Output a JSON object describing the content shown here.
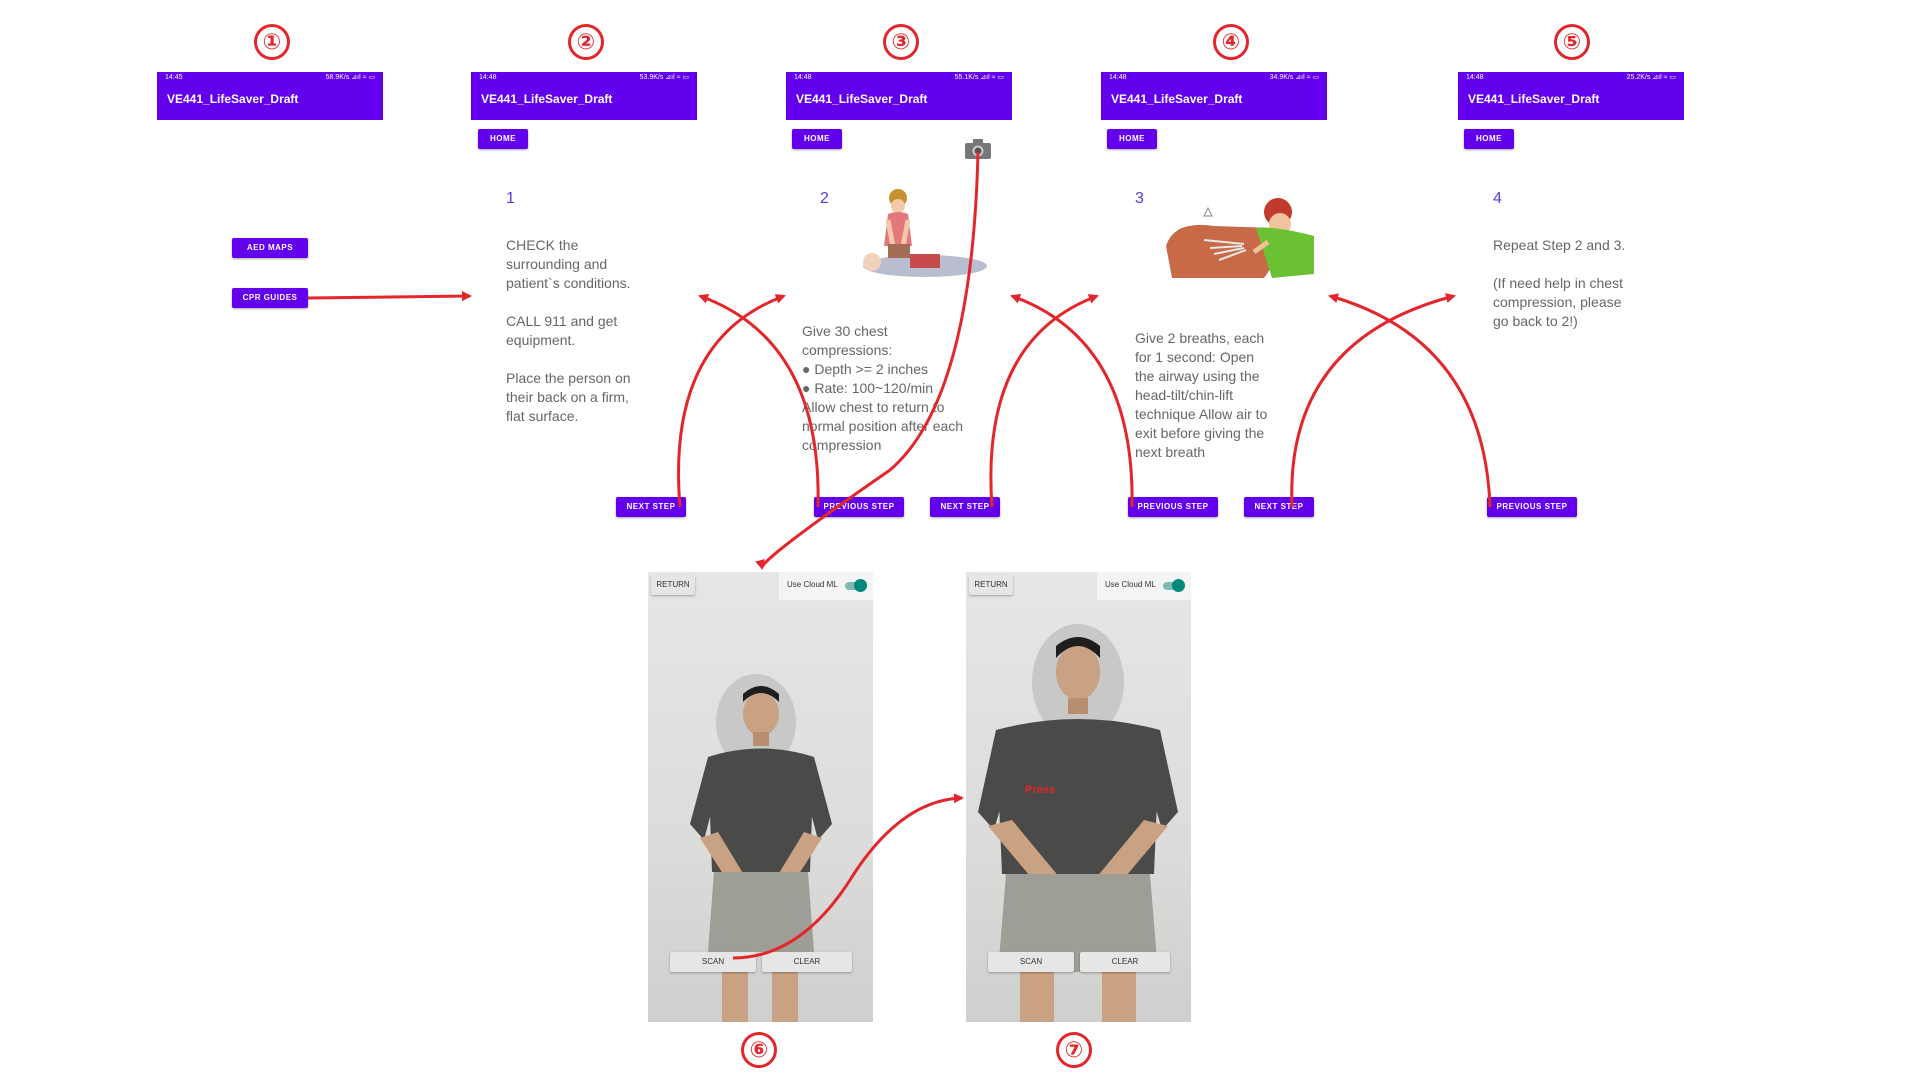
{
  "badges": [
    "①",
    "②",
    "③",
    "④",
    "⑤",
    "⑥",
    "⑦"
  ],
  "app_title": "VE441_LifeSaver_Draft",
  "status_bars": [
    {
      "time": "14:45",
      "right": "58.9K/s ⊿ıl ≈ ▭"
    },
    {
      "time": "14:48",
      "right": "53.9K/s ⊿ıl ≈ ▭"
    },
    {
      "time": "14:48",
      "right": "55.1K/s ⊿ıl ≈ ▭"
    },
    {
      "time": "14:48",
      "right": "34.9K/s ⊿ıl ≈ ▭"
    },
    {
      "time": "14:48",
      "right": "25.2K/s ⊿ıl ≈ ▭"
    }
  ],
  "home_label": "HOME",
  "screen1": {
    "aed_maps": "AED MAPS",
    "cpr_guides": "CPR GUIDES"
  },
  "steps": [
    {
      "num": "1",
      "text": "CHECK the\nsurrounding and\npatient`s conditions.\n\nCALL 911 and get\nequipment.\n\nPlace the person on\ntheir back on a firm,\nflat surface."
    },
    {
      "num": "2",
      "text": "Give 30 chest\ncompressions:\n● Depth >= 2 inches\n● Rate: 100~120/min\nAllow chest to return to\nnormal position after each\ncompression"
    },
    {
      "num": "3",
      "text": "Give 2 breaths, each\nfor 1 second:  Open\nthe airway using the\nhead-tilt/chin-lift\ntechnique  Allow air to\nexit before giving the\nnext breath"
    },
    {
      "num": "4",
      "text": "Repeat Step 2 and 3.\n\n(If need help in chest\ncompression, please\ngo back to 2!)"
    }
  ],
  "next_step_label": "NEXT STEP",
  "previous_step_label": "PREVIOUS STEP",
  "camera": {
    "return_label": "RETURN",
    "toggle_label": "Use Cloud ML",
    "toggle_on": true,
    "scan_label": "SCAN",
    "clear_label": "CLEAR",
    "press_label": "Press"
  },
  "colors": {
    "primary": "#6200ee",
    "arrow": "#e3262b",
    "accent_teal": "#00897b"
  }
}
